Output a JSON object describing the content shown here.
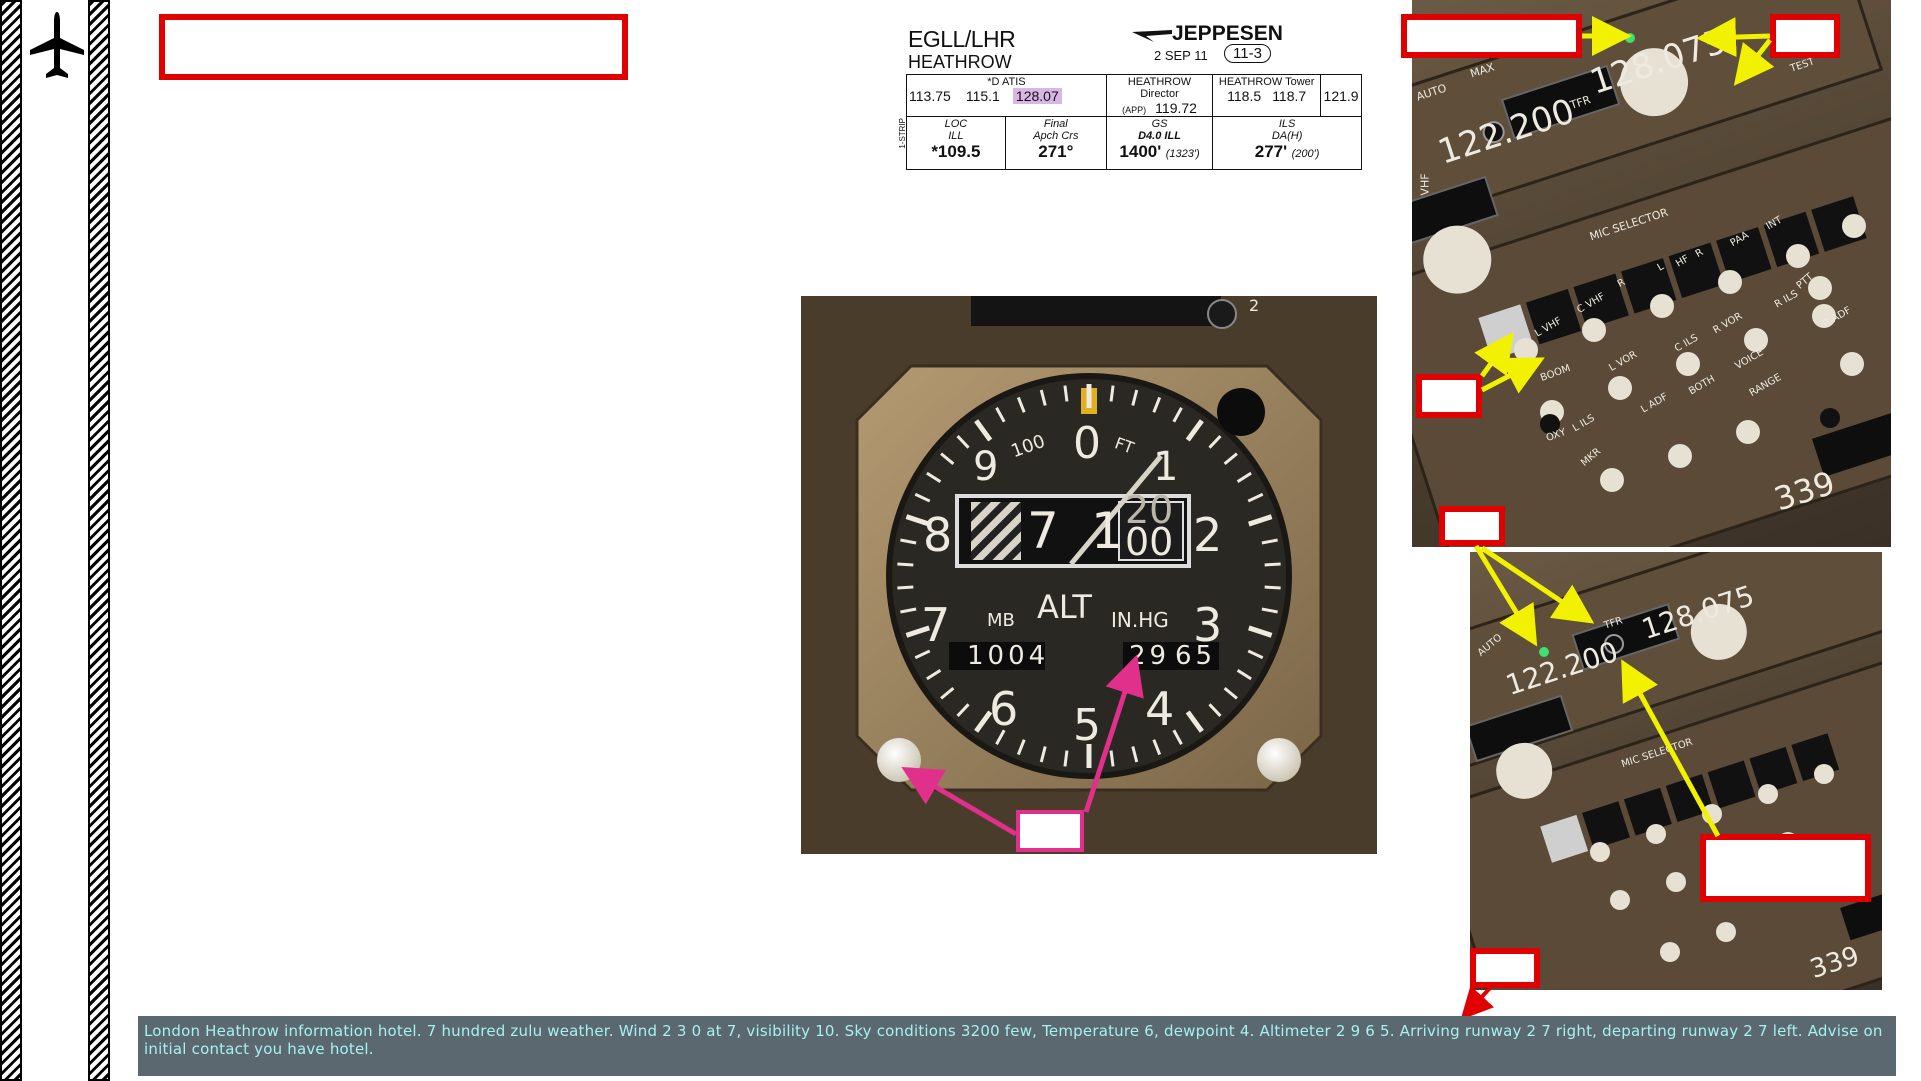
{
  "chart_header": {
    "airport_code": "EGLL/LHR",
    "city": "HEATHROW",
    "publisher": "JEPPESEN",
    "date": "2 SEP 11",
    "page": "11-3",
    "strip_label": "1-STRIP",
    "atis_label": "*D ATIS",
    "atis_freqs": [
      "113.75",
      "115.1",
      "128.07"
    ],
    "director_label": "HEATHROW Director",
    "director_sub": "(APP)",
    "director_freq": "119.72",
    "tower_label": "HEATHROW Tower",
    "tower_freqs": [
      "118.5",
      "118.7"
    ],
    "extra_freq": "121.9",
    "loc_label": "LOC",
    "loc_ident": "ILL",
    "loc_freq": "*109.5",
    "final_label": "Final",
    "final_sub": "Apch Crs",
    "final_value": "271°",
    "gs_label": "GS",
    "gs_sub": "D4.0 ILL",
    "gs_value": "1400'",
    "gs_value_sub": "(1323')",
    "ils_label": "ILS",
    "ils_sub": "DA(H)",
    "ils_value": "277'",
    "ils_value_sub": "(200')"
  },
  "altimeter": {
    "dial_numbers": [
      "0",
      "1",
      "2",
      "3",
      "4",
      "5",
      "6",
      "7",
      "8",
      "9"
    ],
    "label_100": "100",
    "label_ft": "FT",
    "label_alt": "ALT",
    "label_mb": "MB",
    "label_inhg": "IN.HG",
    "counter_thousands": "7",
    "counter_hundreds": "1",
    "counter_tens_top": "20",
    "counter_tens_bottom": "00",
    "mb_value": "1004",
    "inhg_left": "29",
    "inhg_right": "65",
    "corner_mark": "2"
  },
  "upper_panel": {
    "vhf_active": "128.075",
    "vhf_standby": "122.200",
    "label_tfr": "TFR",
    "label_auto": "AUTO",
    "label_max": "MAX",
    "label_vhf": "VHF",
    "label_test": "TEST",
    "mic_selector": "MIC SELECTOR",
    "mic_labels": [
      "L VHF",
      "C VHF",
      "R",
      "L",
      "HF",
      "R",
      "PAA",
      "INT"
    ],
    "knob_labels": [
      "L VOR",
      "C ILS",
      "R VOR",
      "R ILS",
      "R ADF",
      "L ILS",
      "L ADF",
      "BOTH",
      "VOICE",
      "RANGE",
      "BOOM",
      "OXY",
      "MKR",
      "PTT"
    ],
    "display_value": "339"
  },
  "lower_panel": {
    "vhf_active": "128.075",
    "vhf_standby": "122.200",
    "label_tfr": "TFR",
    "label_auto": "AUTO",
    "mic_selector": "MIC SELECTOR",
    "display_value": "339"
  },
  "caption": {
    "text": "London Heathrow information hotel. 7 hundred zulu weather. Wind  2 3 0 at  7, visibility 10. Sky conditions 3200 few, Temperature  6, dewpoint  4. Altimeter  2 9 6 5. Arriving runway 2 7 right, departing runway 2 7 left. Advise on initial contact you have hotel."
  },
  "colors": {
    "callout_red": "#e10000",
    "arrow_yellow": "#f2f200",
    "arrow_pink": "#e0308c",
    "caption_bg": "#5b6870",
    "caption_text": "#a5f2ef",
    "highlight_purple": "#d8b6e6"
  }
}
